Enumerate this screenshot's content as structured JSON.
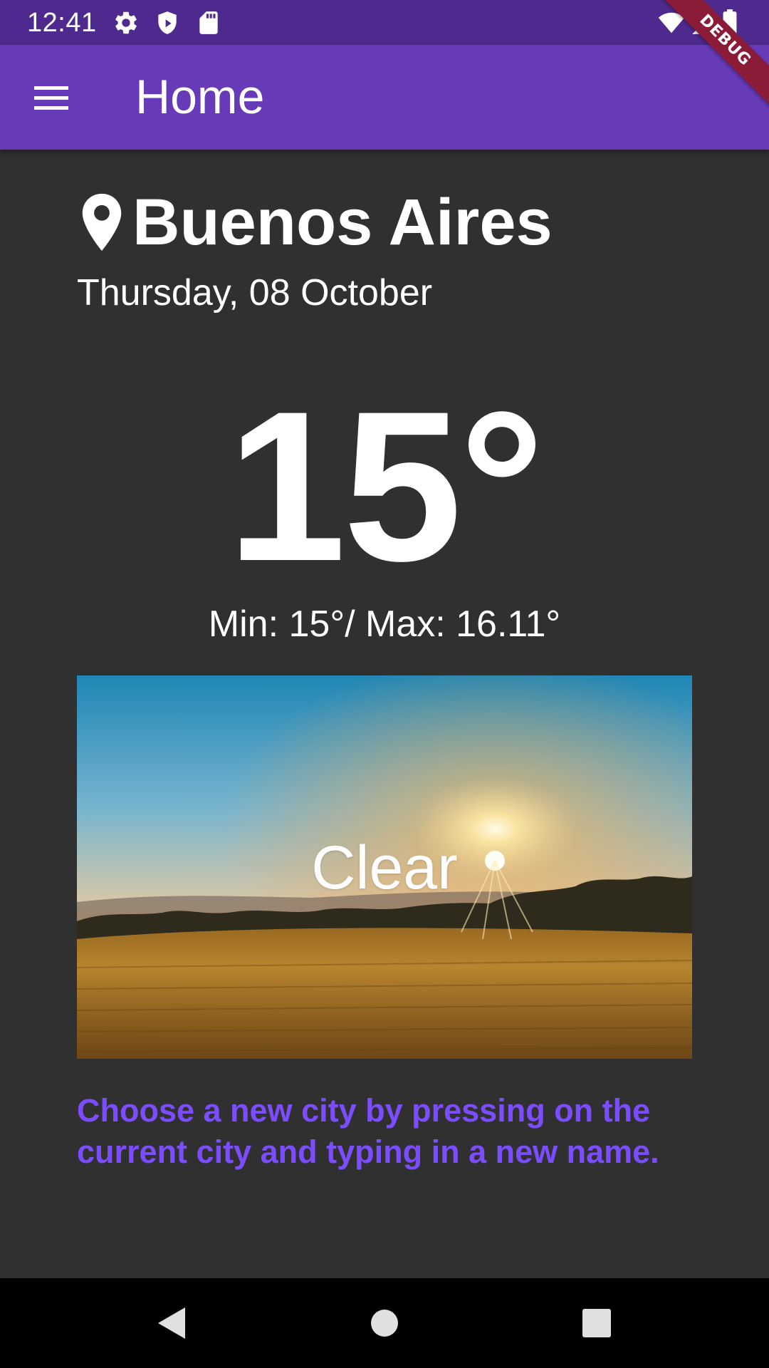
{
  "status_bar": {
    "time": "12:41",
    "icons": [
      "settings-icon",
      "shield-icon",
      "sd-card-icon",
      "wifi-icon",
      "cell-signal-icon",
      "battery-icon"
    ],
    "background": "#4e2a8e"
  },
  "debug_banner": {
    "label": "DEBUG",
    "color": "#8a1c38"
  },
  "app_bar": {
    "title": "Home",
    "menu_icon": "menu-icon",
    "background": "#673ab7"
  },
  "weather": {
    "location_icon": "location-pin-icon",
    "city": "Buenos Aires",
    "date": "Thursday, 08 October",
    "temperature": "15°",
    "min_max": "Min: 15°/ Max: 16.11°",
    "condition": "Clear"
  },
  "hint": {
    "text": "Choose a new city by pressing on the current city and typing in a new name.",
    "color": "#7c4dff"
  },
  "nav_bar": {
    "icons": [
      "back-icon",
      "home-icon",
      "recents-icon"
    ]
  },
  "colors": {
    "background": "#303030",
    "text": "#ffffff"
  }
}
